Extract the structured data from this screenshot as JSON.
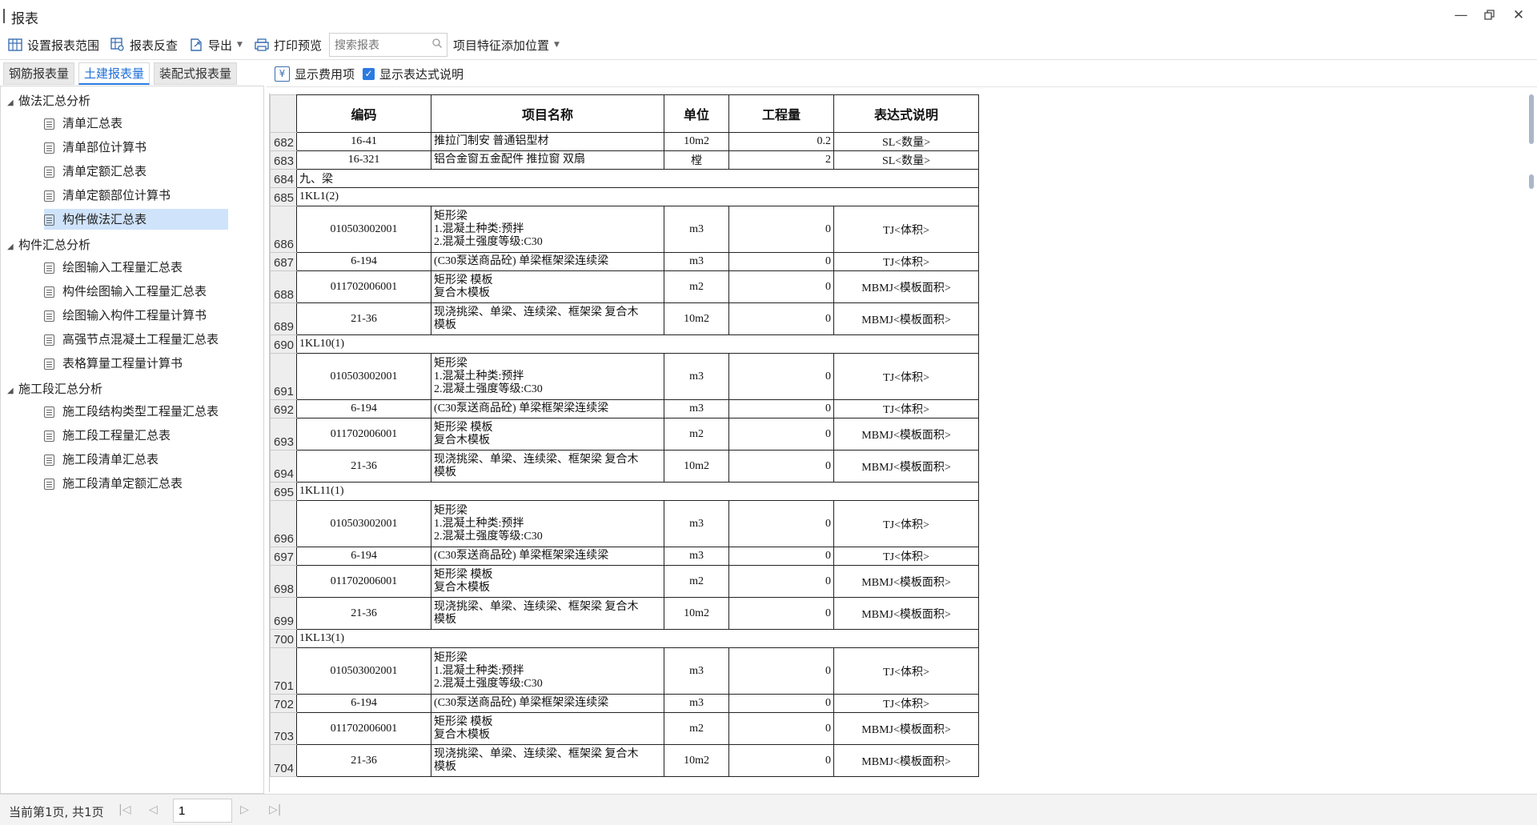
{
  "window": {
    "title": "报表"
  },
  "toolbar": {
    "set_range": "设置报表范围",
    "reverse_check": "报表反查",
    "export": "导出",
    "print_preview": "打印预览",
    "search_placeholder": "搜索报表",
    "feature_position": "项目特征添加位置"
  },
  "tabs": [
    "钢筋报表量",
    "土建报表量",
    "装配式报表量"
  ],
  "tree": {
    "group1": "做法汇总分析",
    "group1_items": [
      "清单汇总表",
      "清单部位计算书",
      "清单定额汇总表",
      "清单定额部位计算书",
      "构件做法汇总表"
    ],
    "group2": "构件汇总分析",
    "group2_items": [
      "绘图输入工程量汇总表",
      "构件绘图输入工程量汇总表",
      "绘图输入构件工程量计算书",
      "高强节点混凝土工程量汇总表",
      "表格算量工程量计算书"
    ],
    "group3": "施工段汇总分析",
    "group3_items": [
      "施工段结构类型工程量汇总表",
      "施工段工程量汇总表",
      "施工段清单汇总表",
      "施工段清单定额汇总表"
    ]
  },
  "options": {
    "show_fee": "显示费用项",
    "show_expr": "显示表达式说明"
  },
  "table": {
    "headers": [
      "编码",
      "项目名称",
      "单位",
      "工程量",
      "表达式说明"
    ],
    "rows": [
      {
        "no": "682",
        "code": "16-41",
        "name": "推拉门制安 普通铝型材",
        "unit": "10m2",
        "qty": "0.2",
        "expr": "SL<数量>"
      },
      {
        "no": "683",
        "code": "16-321",
        "name": "铝合金窗五金配件 推拉窗 双扇",
        "unit": "樘",
        "qty": "2",
        "expr": "SL<数量>"
      },
      {
        "no": "684",
        "section": "九、梁"
      },
      {
        "no": "685",
        "section": "1KL1(2)"
      },
      {
        "no": "686",
        "code": "010503002001",
        "name": "矩形梁\n1.混凝土种类:预拌\n2.混凝土强度等级:C30",
        "unit": "m3",
        "qty": "0",
        "expr": "TJ<体积>"
      },
      {
        "no": "687",
        "code": "6-194",
        "name": "(C30泵送商品砼) 单梁框架梁连续梁",
        "unit": "m3",
        "qty": "0",
        "expr": "TJ<体积>"
      },
      {
        "no": "688",
        "code": "011702006001",
        "name": "矩形梁 模板\n复合木模板",
        "unit": "m2",
        "qty": "0",
        "expr": "MBMJ<模板面积>"
      },
      {
        "no": "689",
        "code": "21-36",
        "name": "现浇挑梁、单梁、连续梁、框架梁 复合木\n模板",
        "unit": "10m2",
        "qty": "0",
        "expr": "MBMJ<模板面积>"
      },
      {
        "no": "690",
        "section": "1KL10(1)"
      },
      {
        "no": "691",
        "code": "010503002001",
        "name": "矩形梁\n1.混凝土种类:预拌\n2.混凝土强度等级:C30",
        "unit": "m3",
        "qty": "0",
        "expr": "TJ<体积>"
      },
      {
        "no": "692",
        "code": "6-194",
        "name": "(C30泵送商品砼) 单梁框架梁连续梁",
        "unit": "m3",
        "qty": "0",
        "expr": "TJ<体积>"
      },
      {
        "no": "693",
        "code": "011702006001",
        "name": "矩形梁 模板\n复合木模板",
        "unit": "m2",
        "qty": "0",
        "expr": "MBMJ<模板面积>"
      },
      {
        "no": "694",
        "code": "21-36",
        "name": "现浇挑梁、单梁、连续梁、框架梁 复合木\n模板",
        "unit": "10m2",
        "qty": "0",
        "expr": "MBMJ<模板面积>"
      },
      {
        "no": "695",
        "section": "1KL11(1)"
      },
      {
        "no": "696",
        "code": "010503002001",
        "name": "矩形梁\n1.混凝土种类:预拌\n2.混凝土强度等级:C30",
        "unit": "m3",
        "qty": "0",
        "expr": "TJ<体积>"
      },
      {
        "no": "697",
        "code": "6-194",
        "name": "(C30泵送商品砼) 单梁框架梁连续梁",
        "unit": "m3",
        "qty": "0",
        "expr": "TJ<体积>"
      },
      {
        "no": "698",
        "code": "011702006001",
        "name": "矩形梁 模板\n复合木模板",
        "unit": "m2",
        "qty": "0",
        "expr": "MBMJ<模板面积>"
      },
      {
        "no": "699",
        "code": "21-36",
        "name": "现浇挑梁、单梁、连续梁、框架梁 复合木\n模板",
        "unit": "10m2",
        "qty": "0",
        "expr": "MBMJ<模板面积>"
      },
      {
        "no": "700",
        "section": "1KL13(1)"
      },
      {
        "no": "701",
        "code": "010503002001",
        "name": "矩形梁\n1.混凝土种类:预拌\n2.混凝土强度等级:C30",
        "unit": "m3",
        "qty": "0",
        "expr": "TJ<体积>"
      },
      {
        "no": "702",
        "code": "6-194",
        "name": "(C30泵送商品砼) 单梁框架梁连续梁",
        "unit": "m3",
        "qty": "0",
        "expr": "TJ<体积>"
      },
      {
        "no": "703",
        "code": "011702006001",
        "name": "矩形梁 模板\n复合木模板",
        "unit": "m2",
        "qty": "0",
        "expr": "MBMJ<模板面积>"
      },
      {
        "no": "704",
        "code": "21-36",
        "name": "现浇挑梁、单梁、连续梁、框架梁 复合木\n模板",
        "unit": "10m2",
        "qty": "0",
        "expr": "MBMJ<模板面积>"
      }
    ]
  },
  "status": {
    "page_info": "当前第1页, 共1页",
    "page_value": "1"
  }
}
